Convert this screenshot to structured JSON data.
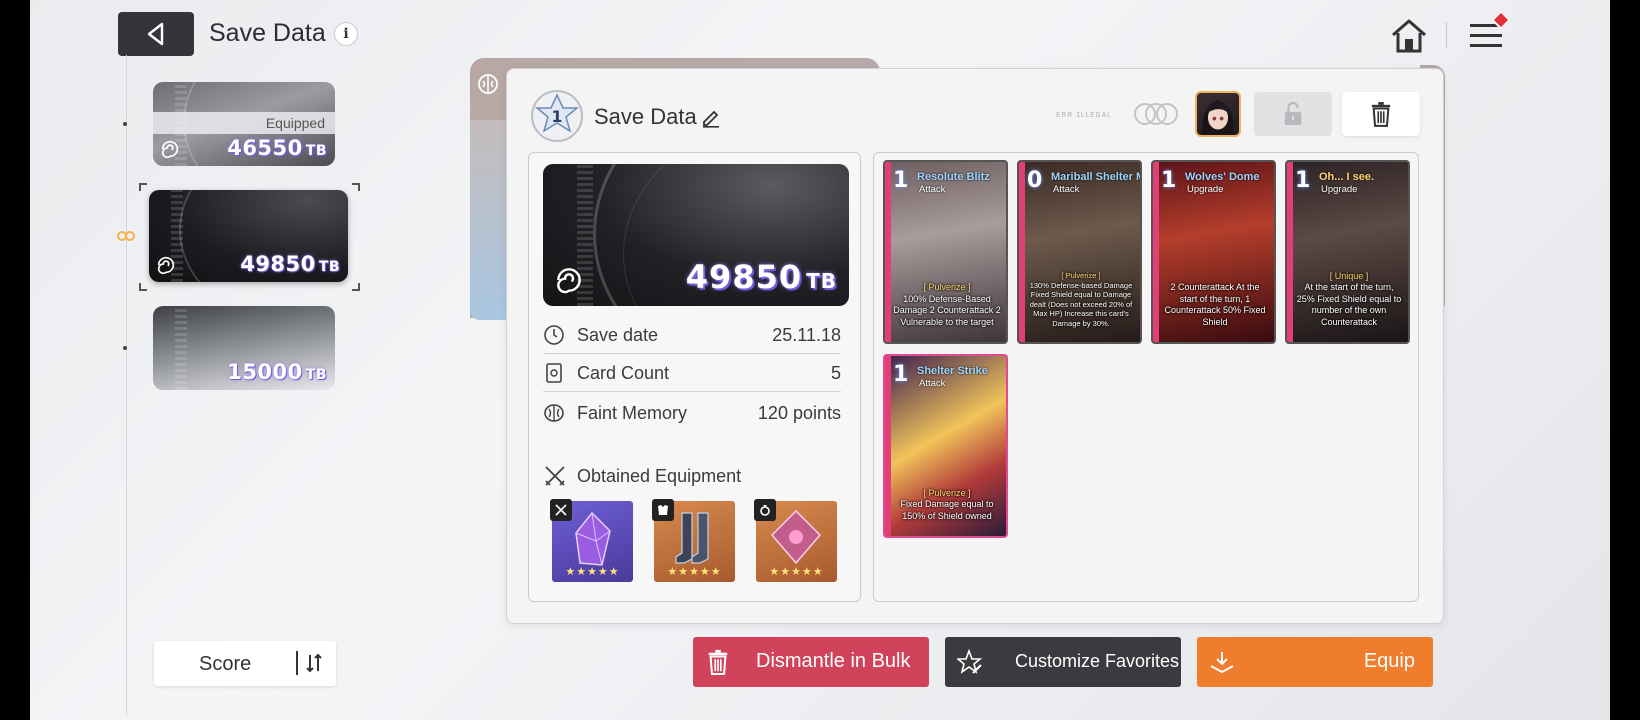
{
  "header": {
    "title": "Save Data",
    "info_glyph": "i"
  },
  "save_list": [
    {
      "value": "46550",
      "unit": "TB",
      "status": "Equipped"
    },
    {
      "value": "49850",
      "unit": "TB",
      "status": ""
    },
    {
      "value": "15000",
      "unit": "TB",
      "status": ""
    }
  ],
  "sort": {
    "label": "Score"
  },
  "detail": {
    "level": "1",
    "name": "Save Data",
    "faint_text": "ᴇʀʀ ɪʟʟᴇɢᴀʟ",
    "big_value": "49850",
    "big_unit": "TB",
    "stats": [
      {
        "label": "Save date",
        "value": "25.11.18",
        "icon": "clock-icon"
      },
      {
        "label": "Card Count",
        "value": "5",
        "icon": "card-icon"
      },
      {
        "label": "Faint Memory",
        "value": "120 points",
        "icon": "brain-icon"
      }
    ],
    "equipment_label": "Obtained Equipment",
    "equipment": [
      {
        "name": "purple crystal",
        "type": "weapon-icon",
        "stars": "★★★★★"
      },
      {
        "name": "armored boots",
        "type": "armor-icon",
        "stars": "★★★★★"
      },
      {
        "name": "pink gem",
        "type": "ring-icon",
        "stars": "★★★★★"
      }
    ]
  },
  "cards": [
    {
      "cost": "1",
      "name": "Resolute Blitz",
      "type": "Attack",
      "tag": "[ Pulverize ]",
      "desc": "100% Defense-Based Damage 2 Counterattack 2 Vulnerable to the target"
    },
    {
      "cost": "0",
      "name": "Mariball Shelter MK.II",
      "type": "Attack",
      "tag": "[ Pulverize ]",
      "desc": "130% Defense-based Damage Fixed Shield equal to Damage dealt (Does not exceed 20% of Max HP) Increase this card's Damage by 30%."
    },
    {
      "cost": "1",
      "name": "Wolves' Dome",
      "type": "Upgrade",
      "tag": "",
      "desc": "2 Counterattack At the start of the turn, 1 Counterattack 50% Fixed Shield"
    },
    {
      "cost": "1",
      "name": "Oh... I see.",
      "type": "Upgrade",
      "tag": "[ Unique ]",
      "desc": "At the start of the turn, 25% Fixed Shield equal to number of the own Counterattack"
    },
    {
      "cost": "1",
      "name": "Shelter Strike",
      "type": "Attack",
      "tag": "[ Pulverize ]",
      "desc": "Fixed Damage equal to 150% of Shield owned"
    }
  ],
  "actions": {
    "dismantle": "Dismantle in Bulk",
    "favorites": "Customize Favorites",
    "equip": "Equip"
  },
  "colors": {
    "dismantle": "#d0435b",
    "favorites": "#3a3b3e",
    "equip": "#f07d2c",
    "tb_glow": "#8a6cff"
  }
}
